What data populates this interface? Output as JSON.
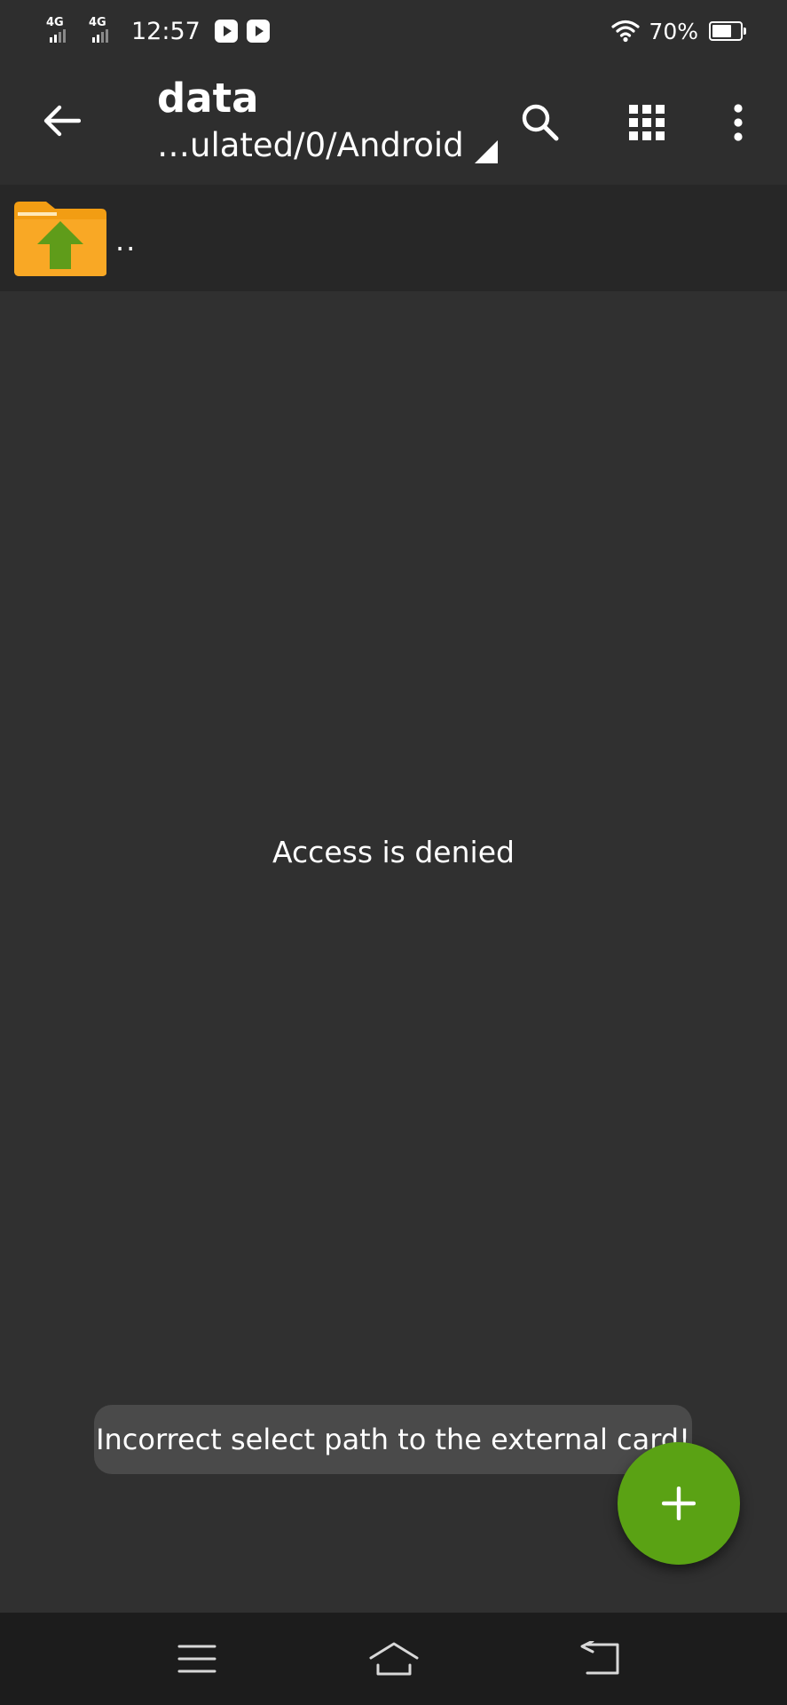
{
  "status_bar": {
    "network_1": "4G",
    "network_2": "4G",
    "time": "12:57",
    "battery_percent": "70%",
    "battery_level": 0.7,
    "icons": [
      "signal-4g-icon",
      "signal-4g-icon",
      "video-app-icon",
      "youtube-icon",
      "wifi-icon",
      "battery-icon"
    ]
  },
  "toolbar": {
    "title": "data",
    "path": "…ulated/0/Android",
    "icons": [
      "back-arrow-icon",
      "search-icon",
      "grid-view-icon",
      "more-vert-icon"
    ]
  },
  "list": {
    "parent_dir_label": ".."
  },
  "content": {
    "message": "Access is denied"
  },
  "toast": {
    "text": "Incorrect select path to the external card!"
  },
  "fab": {
    "icon": "plus-icon",
    "color": "#5aa214"
  },
  "nav_bar": {
    "icons": [
      "menu-icon",
      "home-icon",
      "back-icon"
    ]
  },
  "colors": {
    "background": "#303030",
    "toolbar": "#2e2e2e",
    "folder": "#f9a825",
    "folder_arrow": "#5f9c1a"
  }
}
